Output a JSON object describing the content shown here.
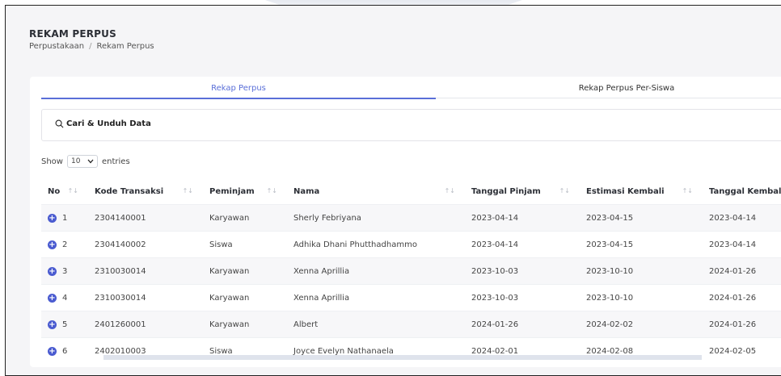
{
  "header": {
    "title": "REKAM PERPUS",
    "breadcrumb": [
      "Perpustakaan",
      "Rekam Perpus"
    ],
    "separator": "/"
  },
  "tabs": [
    {
      "label": "Rekap Perpus",
      "active": true
    },
    {
      "label": "Rekap Perpus Per-Siswa",
      "active": false
    }
  ],
  "search": {
    "label": "Cari & Unduh Data"
  },
  "entries": {
    "show_label": "Show",
    "selected": "10",
    "entries_label": "entries"
  },
  "table": {
    "columns": [
      "No",
      "Kode Transaksi",
      "Peminjam",
      "Nama",
      "Tanggal Pinjam",
      "Estimasi Kembali",
      "Tanggal Kembali"
    ],
    "rows": [
      {
        "no": "1",
        "kode": "2304140001",
        "peminjam": "Karyawan",
        "nama": "Sherly Febriyana",
        "tgl_pinjam": "2023-04-14",
        "estimasi": "2023-04-15",
        "tgl_kembali": "2023-04-14"
      },
      {
        "no": "2",
        "kode": "2304140002",
        "peminjam": "Siswa",
        "nama": "Adhika Dhani Phutthadhammo",
        "tgl_pinjam": "2023-04-14",
        "estimasi": "2023-04-15",
        "tgl_kembali": "2023-04-14"
      },
      {
        "no": "3",
        "kode": "2310030014",
        "peminjam": "Karyawan",
        "nama": "Xenna Aprillia",
        "tgl_pinjam": "2023-10-03",
        "estimasi": "2023-10-10",
        "tgl_kembali": "2024-01-26"
      },
      {
        "no": "4",
        "kode": "2310030014",
        "peminjam": "Karyawan",
        "nama": "Xenna Aprillia",
        "tgl_pinjam": "2023-10-03",
        "estimasi": "2023-10-10",
        "tgl_kembali": "2024-01-26"
      },
      {
        "no": "5",
        "kode": "2401260001",
        "peminjam": "Karyawan",
        "nama": "Albert",
        "tgl_pinjam": "2024-01-26",
        "estimasi": "2024-02-02",
        "tgl_kembali": "2024-01-26"
      },
      {
        "no": "6",
        "kode": "2402010003",
        "peminjam": "Siswa",
        "nama": "Joyce Evelyn Nathanaela",
        "tgl_pinjam": "2024-02-01",
        "estimasi": "2024-02-08",
        "tgl_kembali": "2024-02-05"
      }
    ]
  },
  "icons": {
    "search": "search-icon",
    "expand": "plus-circle-icon",
    "sort": "sort-icon",
    "chevron": "chevron-down-icon"
  },
  "colors": {
    "accent": "#5a6fd8",
    "expand_button": "#4a5bd0",
    "page_bg": "#f5f5f7"
  }
}
